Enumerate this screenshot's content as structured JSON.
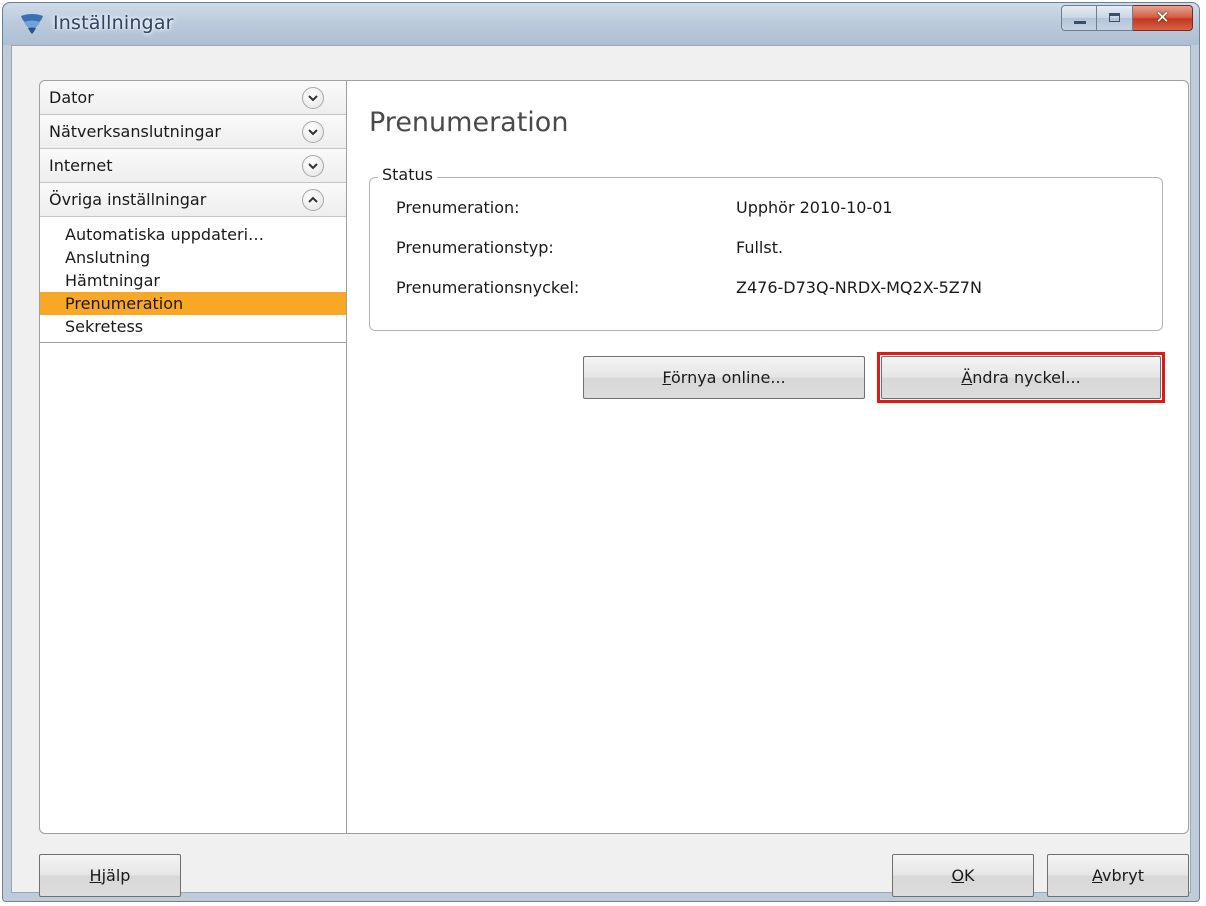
{
  "window": {
    "title": "Inställningar",
    "caption_buttons": [
      "minimize-icon",
      "maximize-icon",
      "close-icon"
    ]
  },
  "nav": {
    "categories": [
      {
        "label": "Dator",
        "expanded": false
      },
      {
        "label": "Nätverksanslutningar",
        "expanded": false
      },
      {
        "label": "Internet",
        "expanded": false
      },
      {
        "label": "Övriga inställningar",
        "expanded": true
      }
    ],
    "subitems": [
      {
        "label": "Automatiska uppdateri…",
        "selected": false
      },
      {
        "label": "Anslutning",
        "selected": false
      },
      {
        "label": "Hämtningar",
        "selected": false
      },
      {
        "label": "Prenumeration",
        "selected": true
      },
      {
        "label": "Sekretess",
        "selected": false
      }
    ],
    "selected_color": "#f9a825"
  },
  "main": {
    "title": "Prenumeration",
    "status_group": {
      "legend": "Status",
      "rows": [
        {
          "label": "Prenumeration:",
          "value": "Upphör 2010-10-01"
        },
        {
          "label": "Prenumerationstyp:",
          "value": "Fullst."
        },
        {
          "label": "Prenumerationsnyckel:",
          "value": "Z476-D73Q-NRDX-MQ2X-5Z7N"
        }
      ]
    },
    "renew_button": {
      "accel": "F",
      "rest": "örnya online..."
    },
    "change_key_button": {
      "accel": "Ä",
      "rest": "ndra nyckel..."
    },
    "highlight_color": "#e01818"
  },
  "footer": {
    "help_button": {
      "accel": "H",
      "rest": "jälp"
    },
    "ok_button": {
      "accel": "O",
      "rest": "K"
    },
    "cancel_button": {
      "accel": "A",
      "rest": "vbryt"
    }
  }
}
